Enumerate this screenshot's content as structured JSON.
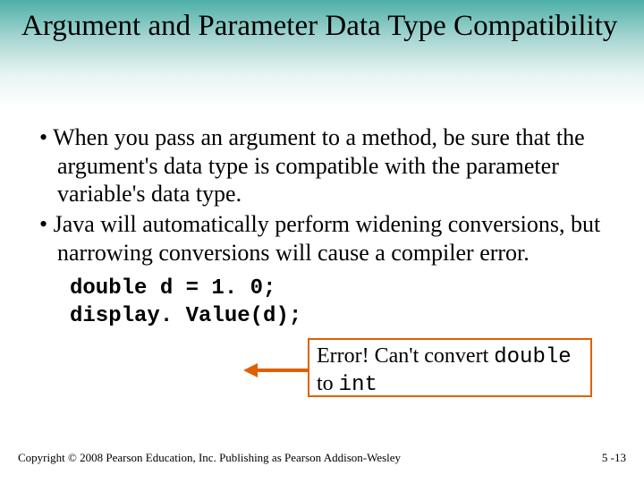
{
  "title": "Argument and Parameter Data Type Compatibility",
  "bullets": [
    "When you pass an argument to a method, be sure that the argument's data type is compatible with the parameter variable's data type.",
    "Java will automatically perform widening conversions, but narrowing conversions will cause a compiler error."
  ],
  "code": {
    "line1": "double d = 1. 0;",
    "line2": "display. Value(d);"
  },
  "error": {
    "prefix": "Error! Can't convert ",
    "type1": "double",
    "mid": " to ",
    "type2": "int"
  },
  "footer": {
    "copyright": "Copyright © 2008 Pearson Education, Inc. Publishing as Pearson Addison-Wesley",
    "page": "5 -13"
  },
  "colors": {
    "accent": "#e06000"
  }
}
